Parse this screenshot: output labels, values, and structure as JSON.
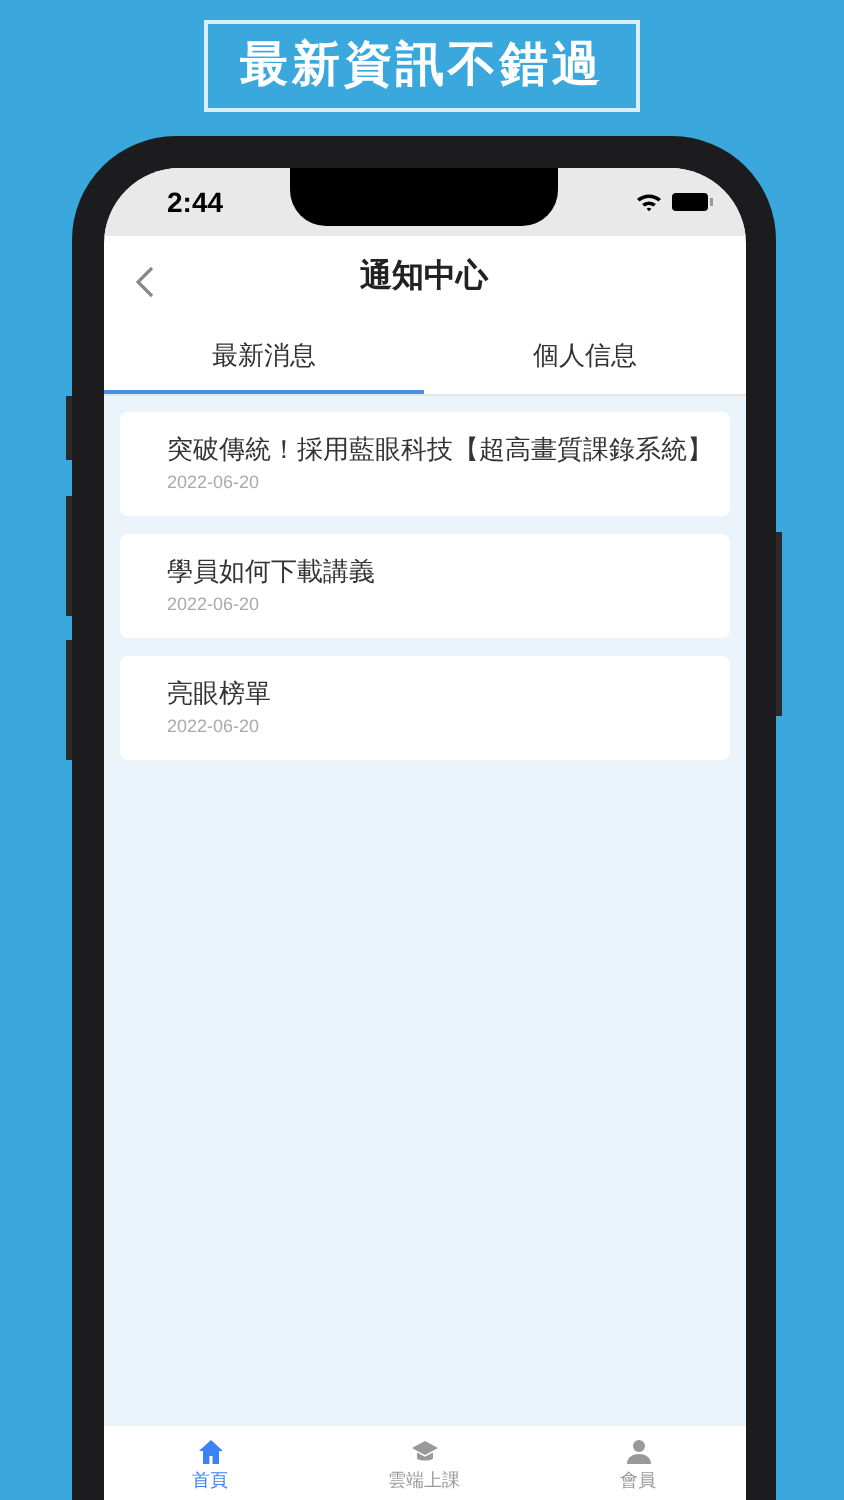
{
  "banner": {
    "title": "最新資訊不錯過"
  },
  "status_bar": {
    "time": "2:44"
  },
  "header": {
    "title": "通知中心"
  },
  "tabs": [
    {
      "label": "最新消息",
      "selected": true
    },
    {
      "label": "個人信息",
      "selected": false
    }
  ],
  "notices": [
    {
      "title": "突破傳統！採用藍眼科技【超高畫質課錄系統】",
      "date": "2022-06-20"
    },
    {
      "title": "學員如何下載講義",
      "date": "2022-06-20"
    },
    {
      "title": "亮眼榜單",
      "date": "2022-06-20"
    }
  ],
  "tab_bar": [
    {
      "label": "首頁",
      "selected": true
    },
    {
      "label": "雲端上課",
      "selected": false
    },
    {
      "label": "會員",
      "selected": false
    }
  ]
}
